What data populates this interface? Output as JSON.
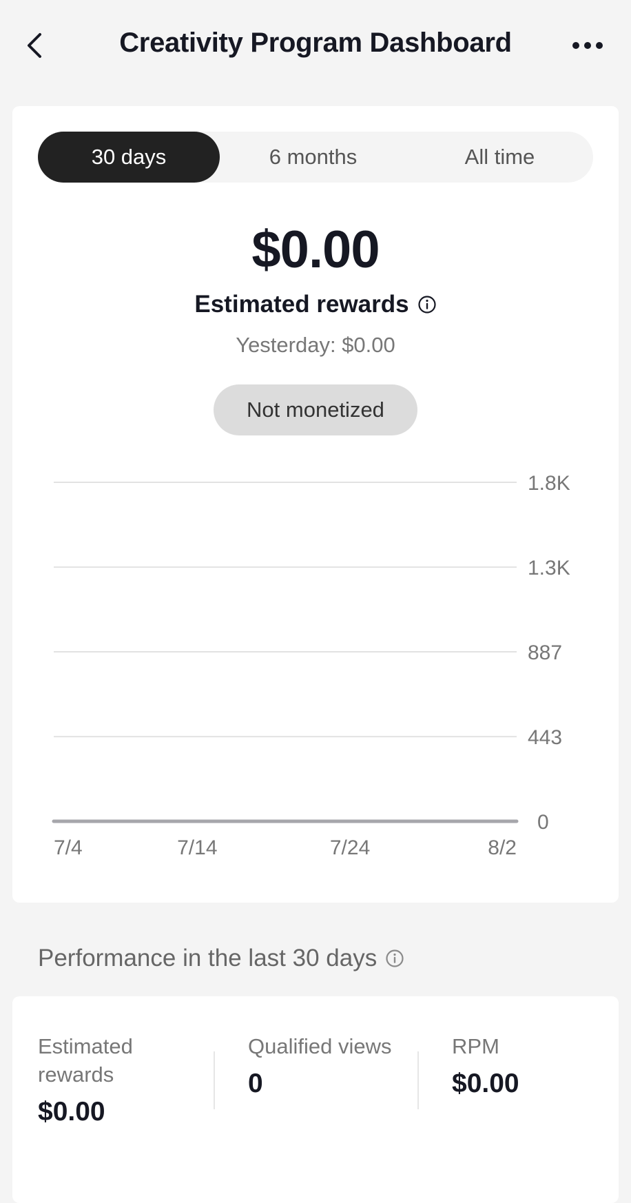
{
  "header": {
    "title": "Creativity Program Dashboard",
    "back_icon": "chevron-left-icon",
    "more_icon": "more-horizontal-icon"
  },
  "tabs": [
    {
      "label": "30 days",
      "active": true
    },
    {
      "label": "6 months",
      "active": false
    },
    {
      "label": "All time",
      "active": false
    }
  ],
  "summary": {
    "amount": "$0.00",
    "label": "Estimated rewards",
    "yesterday": "Yesterday: $0.00",
    "status_badge": "Not monetized"
  },
  "chart_data": {
    "type": "line",
    "x_tick_labels": [
      "7/4",
      "7/14",
      "7/24",
      "8/2"
    ],
    "y_tick_labels": [
      "1.8K",
      "1.3K",
      "887",
      "443",
      "0"
    ],
    "y_ticks": [
      1774,
      1330,
      887,
      443,
      0
    ],
    "ylim": [
      0,
      1774
    ],
    "grid": true,
    "series": [
      {
        "values": [
          0,
          0,
          0,
          0
        ]
      }
    ]
  },
  "performance": {
    "heading": "Performance in the last 30 days",
    "metrics": [
      {
        "label": "Estimated rewards",
        "value": "$0.00"
      },
      {
        "label": "Qualified views",
        "value": "0"
      },
      {
        "label": "RPM",
        "value": "$0.00"
      }
    ]
  },
  "colors": {
    "background": "#f4f4f4",
    "card": "#ffffff",
    "active_tab": "#222222",
    "badge": "#dcdcdc",
    "gridline": "#e2e2e2",
    "series": "#a6a6ab"
  }
}
